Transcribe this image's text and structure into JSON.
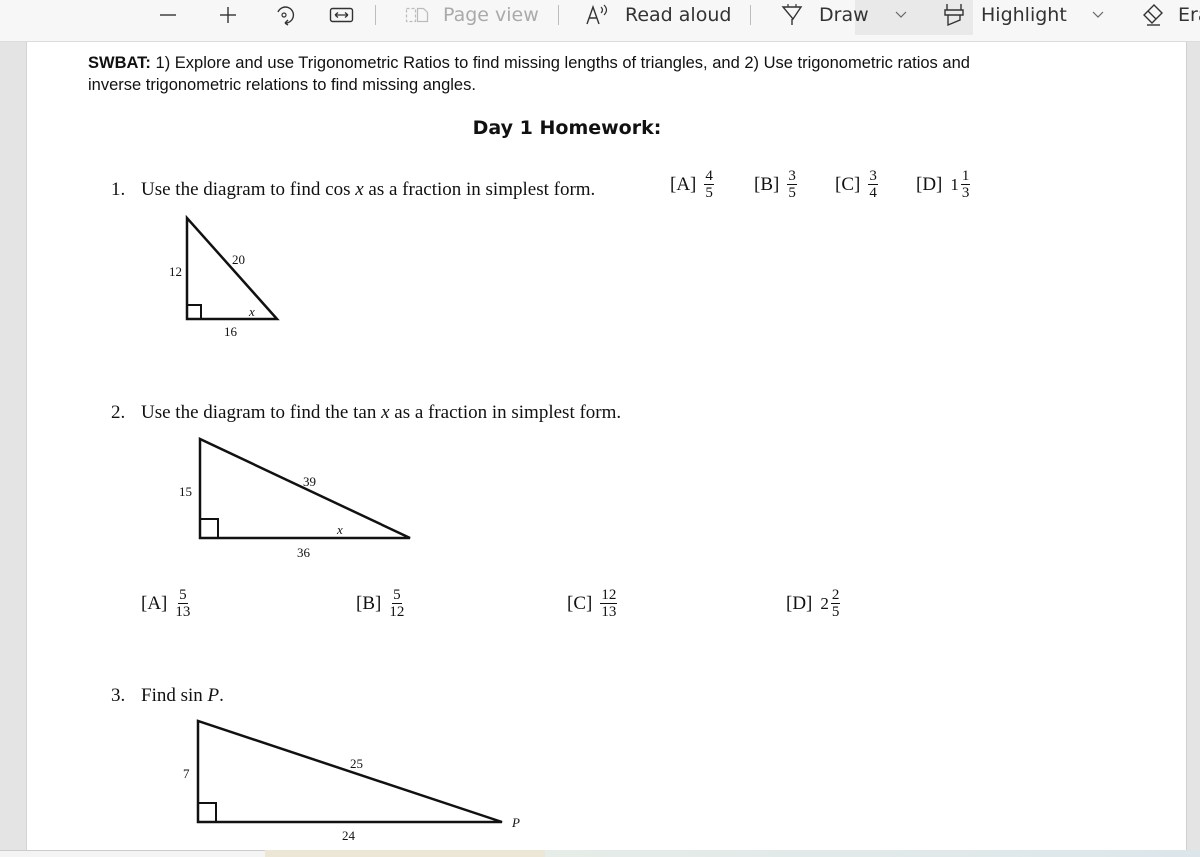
{
  "toolbar": {
    "zoom_out_icon": "minus-icon",
    "zoom_in_icon": "plus-icon",
    "rotate_icon": "rotate-icon",
    "fit_icon": "fit-width-icon",
    "page_view_label": "Page view",
    "read_aloud_label": "Read aloud",
    "draw_label": "Draw",
    "highlight_label": "Highlight",
    "erase_label": "Era"
  },
  "document": {
    "swbat_label": "SWBAT:",
    "swbat_text": " 1) Explore and use Trigonometric Ratios to find missing lengths of triangles, and 2) Use trigonometric ratios and inverse trigonometric relations to find missing angles.",
    "homework_title": "Day 1 Homework:",
    "questions": [
      {
        "number": "1.",
        "text_before": "Use the diagram to find cos ",
        "var": "x",
        "text_after": " as a fraction in simplest form.",
        "diagram": {
          "leg_vertical": "12",
          "hypotenuse": "20",
          "leg_horizontal": "16",
          "angle_label": "x"
        },
        "choices": [
          {
            "label": "[A]",
            "whole": "",
            "numerator": "4",
            "denominator": "5"
          },
          {
            "label": "[B]",
            "whole": "",
            "numerator": "3",
            "denominator": "5"
          },
          {
            "label": "[C]",
            "whole": "",
            "numerator": "3",
            "denominator": "4"
          },
          {
            "label": "[D]",
            "whole": "1",
            "numerator": "1",
            "denominator": "3"
          }
        ]
      },
      {
        "number": "2.",
        "text_before": "Use the diagram to find the tan ",
        "var": "x",
        "text_after": " as a fraction in simplest form.",
        "diagram": {
          "leg_vertical": "15",
          "hypotenuse": "39",
          "leg_horizontal": "36",
          "angle_label": "x"
        },
        "choices": [
          {
            "label": "[A]",
            "whole": "",
            "numerator": "5",
            "denominator": "13"
          },
          {
            "label": "[B]",
            "whole": "",
            "numerator": "5",
            "denominator": "12"
          },
          {
            "label": "[C]",
            "whole": "",
            "numerator": "12",
            "denominator": "13"
          },
          {
            "label": "[D]",
            "whole": "2",
            "numerator": "2",
            "denominator": "5"
          }
        ]
      },
      {
        "number": "3.",
        "text_before": "Find sin ",
        "var": "P",
        "text_after": ".",
        "diagram": {
          "leg_vertical": "7",
          "hypotenuse": "25",
          "leg_horizontal": "24",
          "angle_label": "P"
        }
      }
    ]
  }
}
